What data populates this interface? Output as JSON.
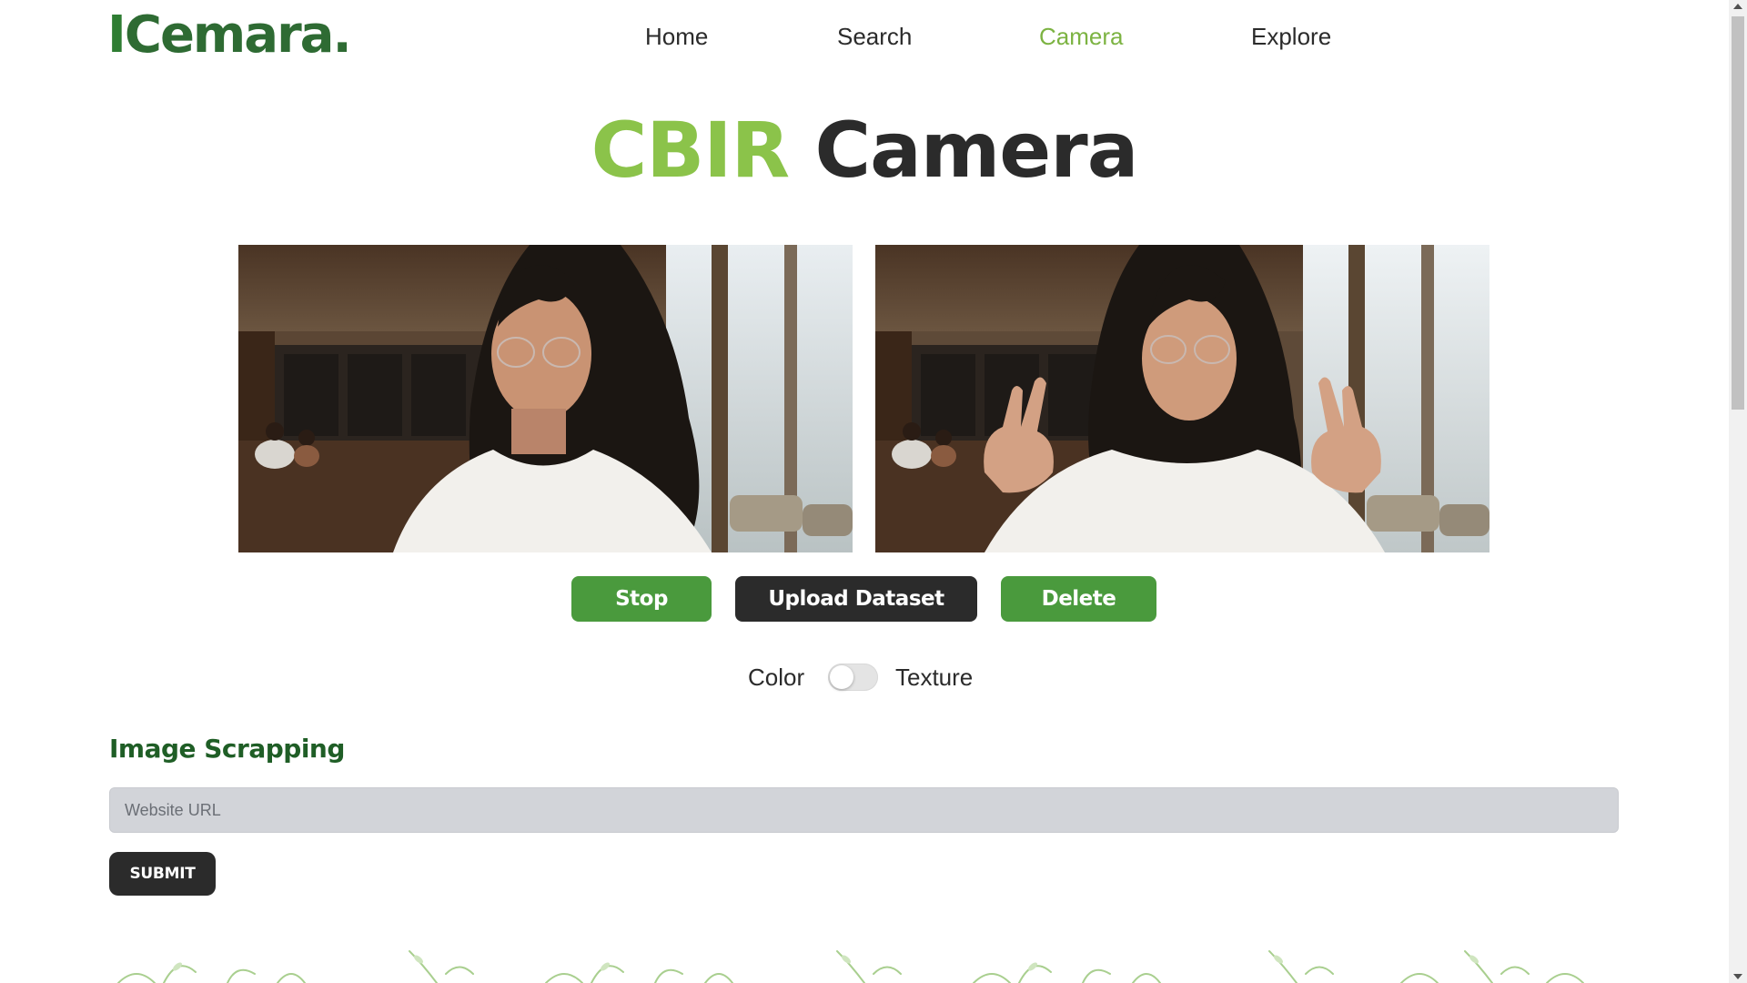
{
  "brand": {
    "logo_text": "Cemara",
    "logo_prefix": "I",
    "logo_dot": "."
  },
  "nav": {
    "items": [
      {
        "label": "Home",
        "active": false
      },
      {
        "label": "Search",
        "active": false
      },
      {
        "label": "Camera",
        "active": true
      },
      {
        "label": "Explore",
        "active": false
      }
    ]
  },
  "title": {
    "accent": "CBIR",
    "main": "Camera"
  },
  "camera": {
    "live_feed_alt": "webcam-live-feed",
    "captured_alt": "captured-frame"
  },
  "actions": {
    "stop_label": "Stop",
    "upload_label": "Upload Dataset",
    "delete_label": "Delete"
  },
  "toggle": {
    "left_label": "Color",
    "right_label": "Texture",
    "value": "Color"
  },
  "scrapping": {
    "heading": "Image Scrapping",
    "url_placeholder": "Website URL",
    "url_value": "",
    "submit_label": "SUBMIT"
  },
  "colors": {
    "accent_green": "#8bc34a",
    "button_green": "#4a9a3d",
    "dark": "#2b2b2b",
    "heading_green": "#1f5e26"
  }
}
